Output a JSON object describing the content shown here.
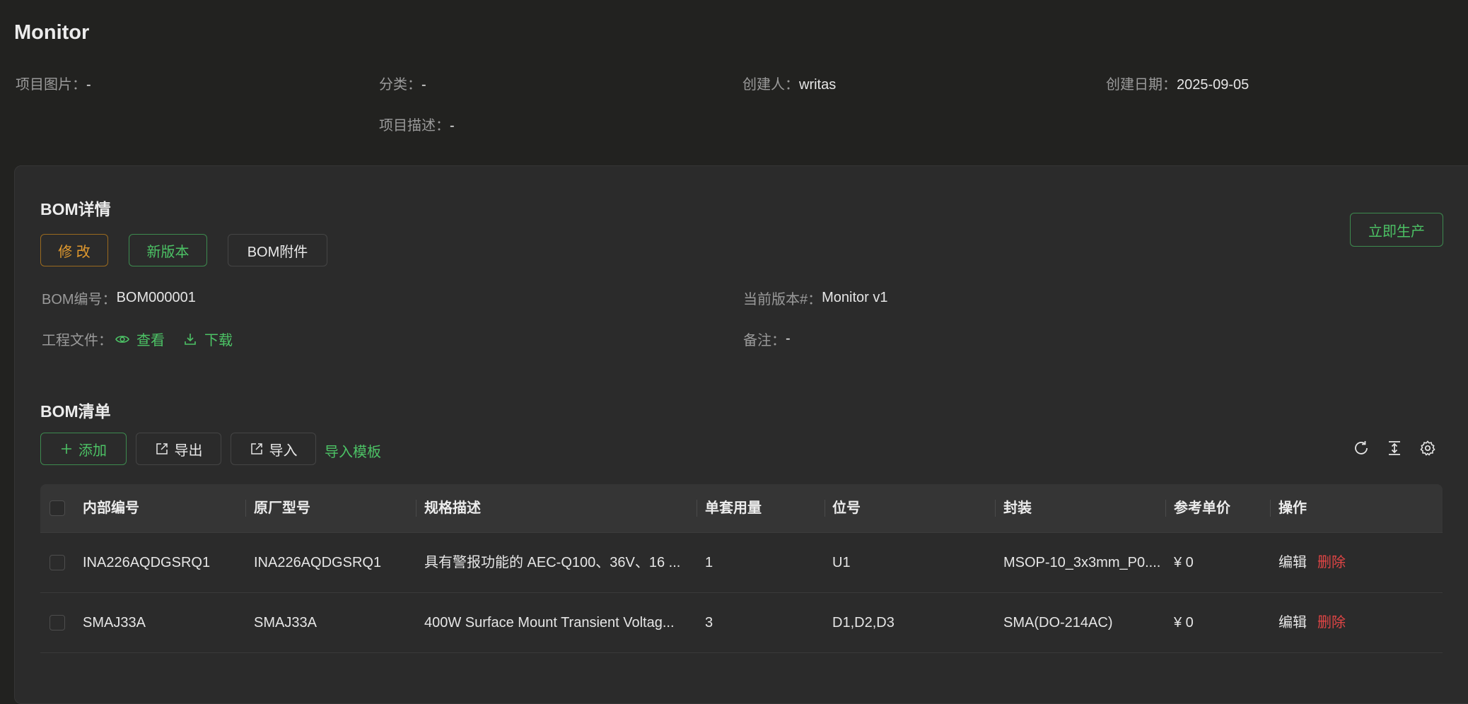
{
  "page": {
    "title": "Monitor"
  },
  "project_meta": [
    {
      "label": "项目图片：",
      "value": "-"
    },
    {
      "label": "分类：",
      "value": "-"
    },
    {
      "label": "创建人：",
      "value": "writas"
    },
    {
      "label": "创建日期：",
      "value": "2025-09-05"
    },
    {
      "label": "项目描述：",
      "value": "-"
    }
  ],
  "bom_detail": {
    "title": "BOM详情",
    "buttons": {
      "edit": "修 改",
      "new_version": "新版本",
      "attachments": "BOM附件",
      "produce": "立即生产"
    },
    "bom_no": {
      "label": "BOM编号：",
      "value": "BOM000001"
    },
    "current_version": {
      "label": "当前版本#：",
      "value": "Monitor v1"
    },
    "project_files": {
      "label": "工程文件：",
      "view": "查看",
      "download": "下载"
    },
    "remark": {
      "label": "备注：",
      "value": "-"
    }
  },
  "bom_list": {
    "title": "BOM清单",
    "toolbar": {
      "add": "添加",
      "export": "导出",
      "import": "导入",
      "import_template": "导入模板"
    },
    "columns": [
      "内部编号",
      "原厂型号",
      "规格描述",
      "单套用量",
      "位号",
      "封装",
      "参考单价",
      "操作"
    ],
    "rows": [
      {
        "internal_no": "INA226AQDGSRQ1",
        "mfr_part": "INA226AQDGSRQ1",
        "spec": "具有警报功能的 AEC-Q100、36V、16 ...",
        "qty": "1",
        "designator": "U1",
        "package": "MSOP-10_3x3mm_P0....",
        "price": "¥ 0",
        "edit": "编辑",
        "delete": "删除"
      },
      {
        "internal_no": "SMAJ33A",
        "mfr_part": "SMAJ33A",
        "spec": "400W Surface Mount Transient Voltag...",
        "qty": "3",
        "designator": "D1,D2,D3",
        "package": "SMA(DO-214AC)",
        "price": "¥ 0",
        "edit": "编辑",
        "delete": "删除"
      }
    ]
  },
  "colors": {
    "accent_green": "#4cc265",
    "accent_orange": "#e29a2e",
    "danger_red": "#e04545",
    "background": "#222220",
    "card": "#2b2b2b"
  }
}
